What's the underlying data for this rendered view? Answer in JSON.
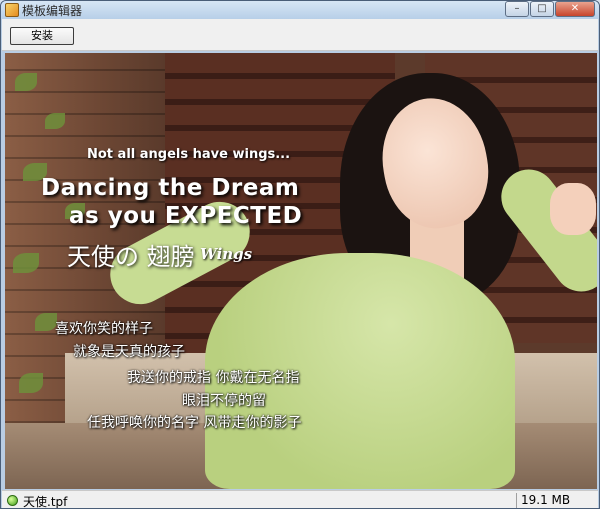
{
  "window": {
    "title": "模板编辑器"
  },
  "toolbar": {
    "install_label": "安装"
  },
  "window_controls": {
    "minimize": "–",
    "maximize": "□",
    "close": "✕"
  },
  "overlay": {
    "tagline": "Not all angels have wings...",
    "headline_1": "Dancing the Dream",
    "headline_2": "as you EXPECTED",
    "cn_title": "天使の 翅膀",
    "wings_script": "Wings"
  },
  "lyrics": [
    "喜欢你笑的样子",
    "就象是天真的孩子",
    "我送你的戒指 你戴在无名指",
    "眼泪不停的留",
    "任我呼唤你的名字 风带走你的影子"
  ],
  "status": {
    "file": "天使.tpf",
    "size": "19.1 MB"
  },
  "colors": {
    "status_led": "#3d9d18",
    "title_bar": "#b7cfe8"
  }
}
